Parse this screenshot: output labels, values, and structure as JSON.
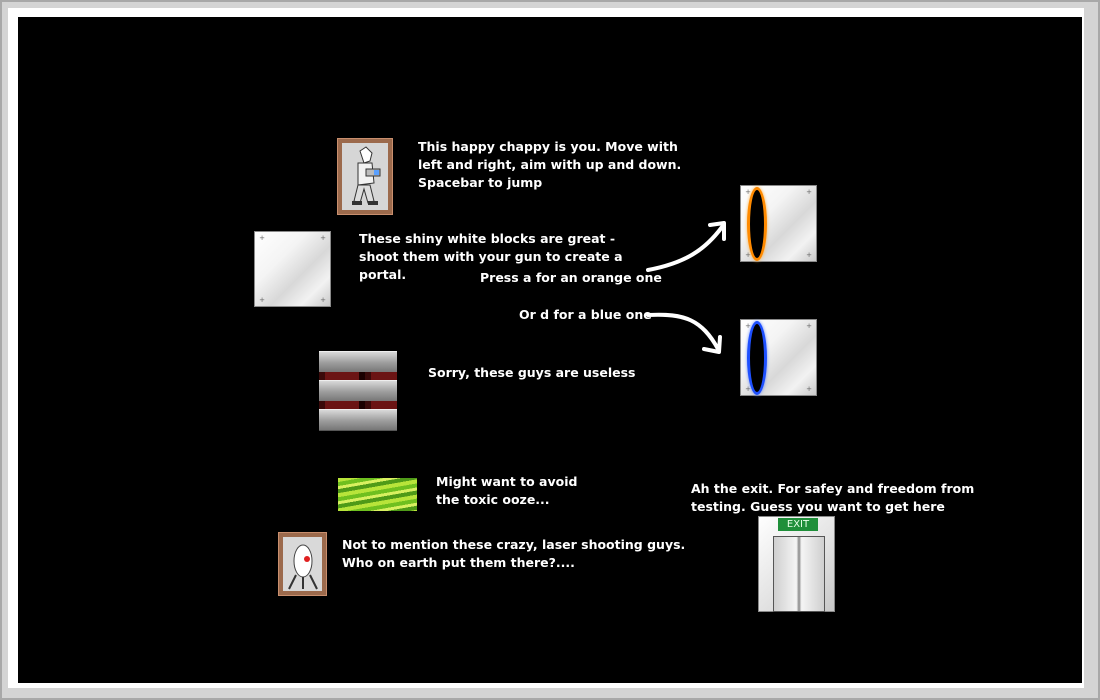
{
  "instructions": {
    "player": "This happy chappy is you. Move with\nleft and right, aim with up and down.\nSpacebar to jump",
    "white_blocks": "These shiny white blocks are great -\nshoot them with your gun to create a\nportal.",
    "orange_portal": "Press a for an orange one",
    "blue_portal": "Or d for a blue one",
    "grates": "Sorry, these guys are useless",
    "ooze": "Might want to avoid\nthe toxic ooze...",
    "turrets": "Not to mention these crazy, laser shooting guys.\nWho on earth put them there?....",
    "exit": "Ah the exit. For safey and freedom from\ntesting. Guess you want to get here"
  },
  "exit_sign": "EXIT",
  "colors": {
    "background": "#000000",
    "text": "#ffffff",
    "orange_portal": "#ff8a00",
    "blue_portal": "#1e50ff",
    "frame": "#9c6a4c",
    "exit_sign": "#1f8f3a"
  },
  "icons": [
    "player-sprite",
    "white-block-icon",
    "grate-icon",
    "toxic-ooze-icon",
    "turret-icon",
    "exit-door-icon",
    "orange-portal-icon",
    "blue-portal-icon",
    "arrow-icon"
  ]
}
